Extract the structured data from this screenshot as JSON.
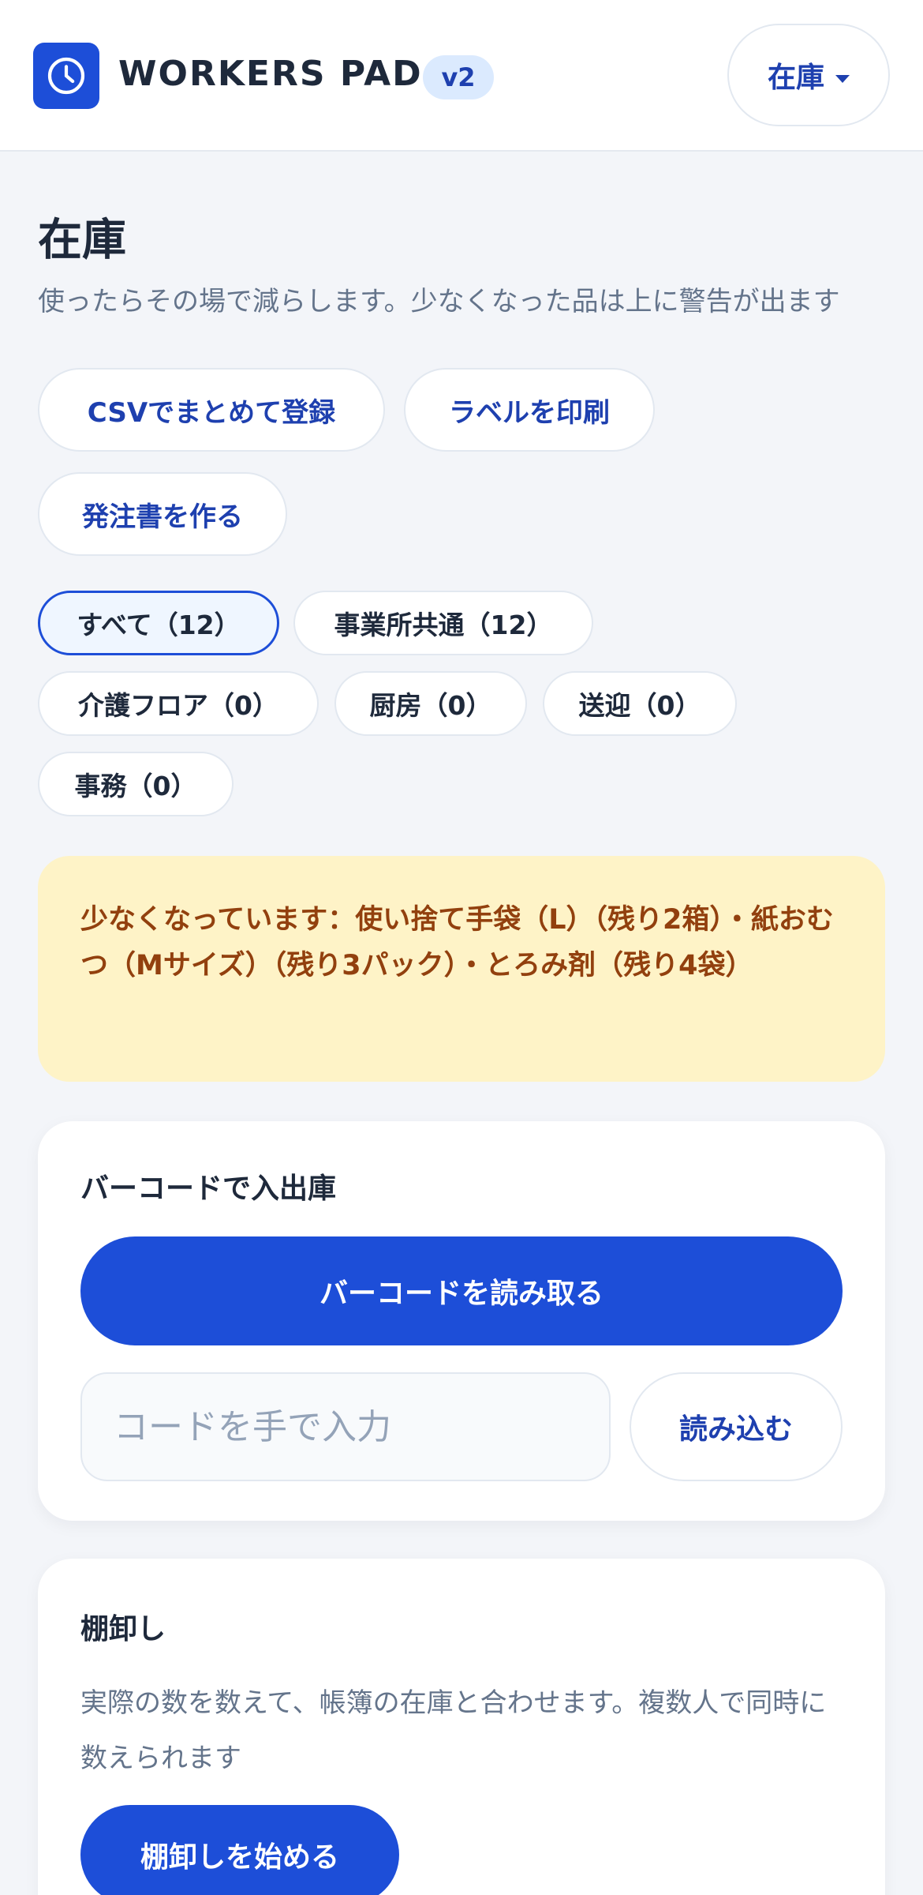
{
  "header": {
    "brand": "WORKERS PAD",
    "version": "v2",
    "menu_label": "在庫",
    "logo_icon": "clock-icon",
    "accent_color": "#1d4ed8"
  },
  "page": {
    "title": "在庫",
    "description": "使ったらその場で減らします。少なくなった品は上に警告が出ます"
  },
  "actions": {
    "csv_import": "CSVでまとめて登録",
    "print_labels": "ラベルを印刷",
    "create_order": "発注書を作る"
  },
  "filters": [
    {
      "label": "すべて（12）",
      "active": true
    },
    {
      "label": "事業所共通（12）",
      "active": false
    },
    {
      "label": "介護フロア（0）",
      "active": false
    },
    {
      "label": "厨房（0）",
      "active": false
    },
    {
      "label": "送迎（0）",
      "active": false
    },
    {
      "label": "事務（0）",
      "active": false
    }
  ],
  "alert": {
    "text": "少なくなっています：使い捨て手袋（L）（残り2箱）・紙おむつ（Mサイズ）（残り3パック）・とろみ剤（残り4袋）",
    "background": "#fef3c7",
    "color": "#92400e"
  },
  "barcode": {
    "title": "バーコードで入出庫",
    "scan_button": "バーコードを読み取る",
    "input_placeholder": "コードを手で入力",
    "input_value": "",
    "load_button": "読み込む"
  },
  "stocktake": {
    "title": "棚卸し",
    "description": "実際の数を数えて、帳簿の在庫と合わせます。複数人で同時に数えられます",
    "start_button": "棚卸しを始める"
  }
}
